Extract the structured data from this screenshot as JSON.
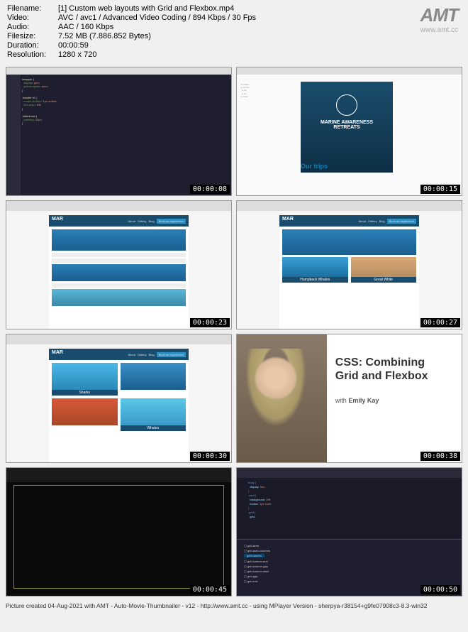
{
  "meta": {
    "filename_label": "Filename:",
    "filename": "[1] Custom web layouts with Grid and Flexbox.mp4",
    "video_label": "Video:",
    "video": "AVC / avc1 / Advanced Video Coding / 894 Kbps / 30 Fps",
    "audio_label": "Audio:",
    "audio": "AAC / 160 Kbps",
    "filesize_label": "Filesize:",
    "filesize": "7.52 MB (7.886.852 Bytes)",
    "duration_label": "Duration:",
    "duration": "00:00:59",
    "resolution_label": "Resolution:",
    "resolution": "1280 x 720"
  },
  "logo": {
    "text": "AMT",
    "sub": "www.amt.cc"
  },
  "thumbs": {
    "t1_ts": "00:00:08",
    "t2_ts": "00:00:15",
    "t2_hero1": "MARINE AWARENESS",
    "t2_hero2": "RETREATS",
    "t2_trips": "Our trips",
    "t3_ts": "00:00:23",
    "t3_logo": "MAR",
    "t4_ts": "00:00:27",
    "t4_c1": "Humpback Whales",
    "t4_c2": "Great White",
    "t5_ts": "00:00:30",
    "t5_sharks": "Sharks",
    "t5_whales": "Whales",
    "t6_ts": "00:00:38",
    "t6_title1": "CSS: Combining",
    "t6_title2": "Grid and Flexbox",
    "t6_with": "with ",
    "t6_author": "Emily Kay",
    "t7_ts": "00:00:45",
    "t8_ts": "00:00:50",
    "t8_sel": "grid-column"
  },
  "nav": {
    "about": "About",
    "gallery": "Gallery",
    "blog": "Blog",
    "book": "Book an experience"
  },
  "footer": "Picture created 04-Aug-2021 with AMT - Auto-Movie-Thumbnailer - v12 - http://www.amt.cc - using MPlayer Version - sherpya-r38154+g9fe07908c3-8.3-win32"
}
